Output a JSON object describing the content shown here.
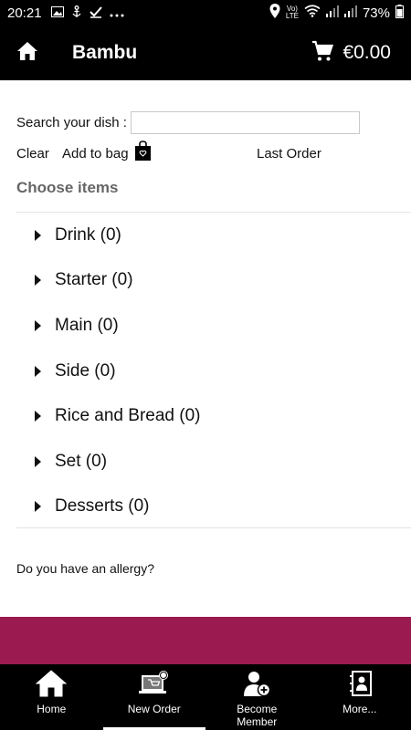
{
  "status_bar": {
    "time": "20:21",
    "net_top": "Vo)",
    "net_bottom": "LTE",
    "battery": "73%"
  },
  "app_bar": {
    "title": "Bambu",
    "cart_total": "€0.00"
  },
  "search": {
    "label": "Search your dish :",
    "value": ""
  },
  "actions": {
    "clear": "Clear",
    "add_to_bag": "Add to bag",
    "last_order": "Last Order"
  },
  "choose_items": "Choose items",
  "categories": [
    {
      "label": "Drink (0)"
    },
    {
      "label": "Starter (0)"
    },
    {
      "label": "Main (0)"
    },
    {
      "label": "Side (0)"
    },
    {
      "label": "Rice and Bread (0)"
    },
    {
      "label": "Set (0)"
    },
    {
      "label": "Desserts (0)"
    }
  ],
  "allergy_question": "Do you have an allergy?",
  "bottom_nav": [
    {
      "label": "Home",
      "icon": "home-icon"
    },
    {
      "label": "New Order",
      "icon": "new-order-icon"
    },
    {
      "label": "Become Member",
      "icon": "add-member-icon"
    },
    {
      "label": "More...",
      "icon": "contacts-icon"
    }
  ],
  "colors": {
    "bar": "#000000",
    "accent_band": "#9b1b51",
    "muted_text": "#666666"
  }
}
